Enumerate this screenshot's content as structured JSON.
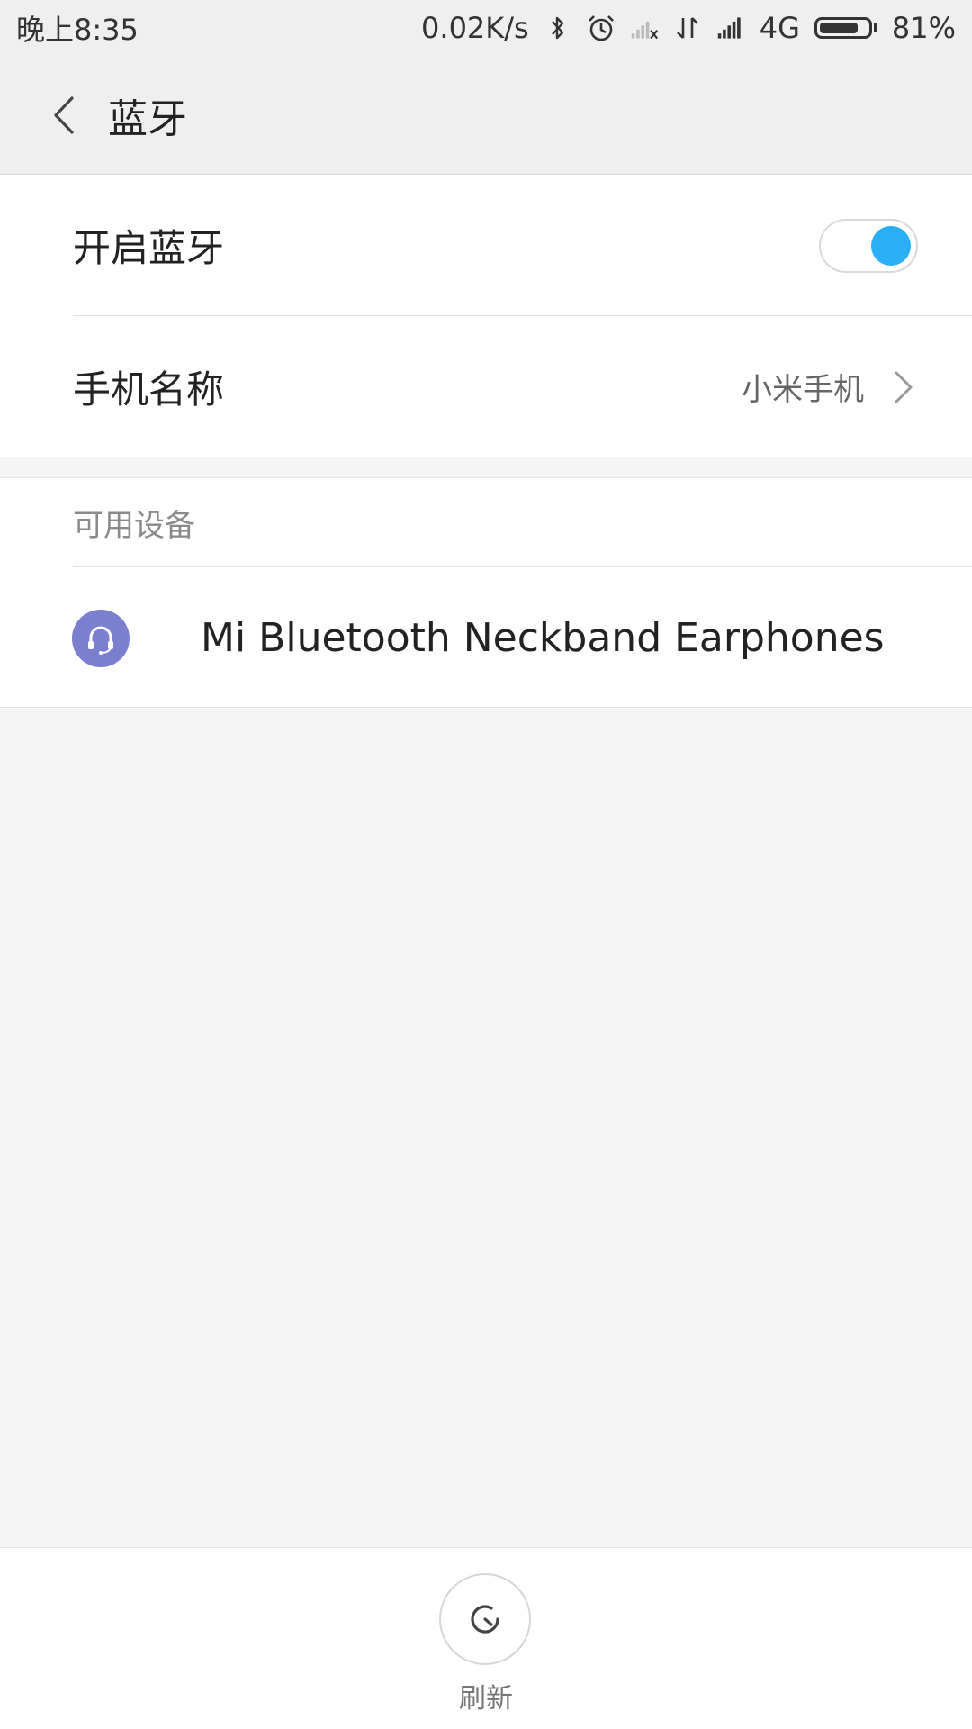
{
  "status_bar": {
    "time": "晚上8:35",
    "net_speed": "0.02K/s",
    "network_type": "4G",
    "battery_percent": "81%",
    "battery_level": 0.81,
    "icons": [
      "bluetooth-icon",
      "alarm-icon",
      "signal-empty-icon",
      "data-transfer-icon",
      "signal-full-icon",
      "battery-icon"
    ]
  },
  "header": {
    "title": "蓝牙"
  },
  "settings": {
    "bluetooth_toggle_label": "开启蓝牙",
    "bluetooth_enabled": true,
    "phone_name_label": "手机名称",
    "phone_name_value": "小米手机"
  },
  "available": {
    "section_title": "可用设备",
    "devices": [
      {
        "name": "Mi Bluetooth Neckband Earphones",
        "icon": "headset-icon"
      }
    ]
  },
  "bottom": {
    "refresh_label": "刷新"
  },
  "colors": {
    "accent": "#2aaef5",
    "device_avatar": "#7b7fd0",
    "background": "#f5f5f5",
    "header_bg": "#efefef"
  }
}
